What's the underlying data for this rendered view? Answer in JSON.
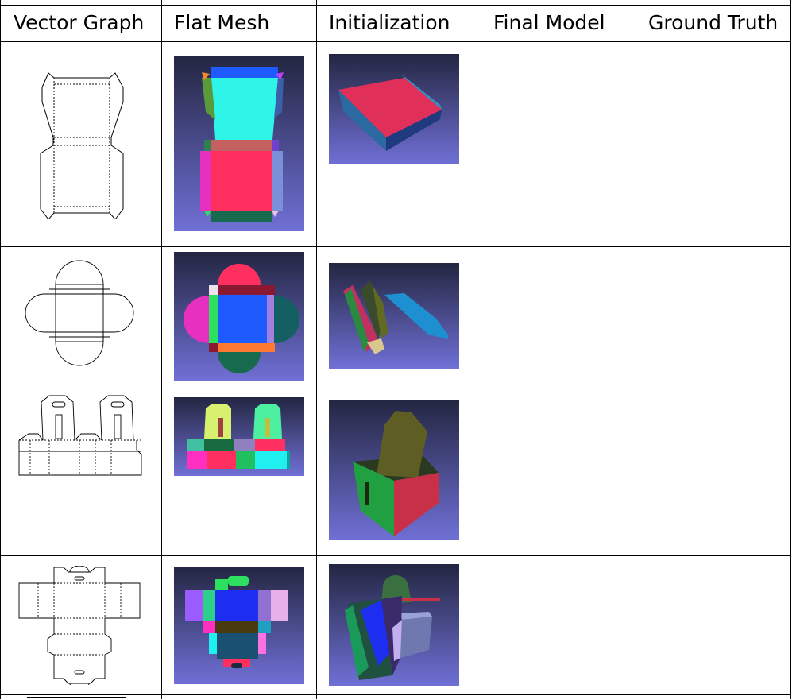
{
  "table": {
    "headers": [
      "Vector Graph",
      "Flat Mesh",
      "Initialization",
      "Final Model",
      "Ground Truth"
    ],
    "rows": [
      {
        "vector_graph": "box-dieline-1",
        "flat_mesh": "flat-mesh-1",
        "initialization": "initialization-1",
        "final_model": "",
        "ground_truth": ""
      },
      {
        "vector_graph": "box-dieline-2",
        "flat_mesh": "flat-mesh-2",
        "initialization": "initialization-2",
        "final_model": "",
        "ground_truth": ""
      },
      {
        "vector_graph": "box-dieline-3",
        "flat_mesh": "flat-mesh-3",
        "initialization": "initialization-3",
        "final_model": "",
        "ground_truth": ""
      },
      {
        "vector_graph": "box-dieline-4",
        "flat_mesh": "flat-mesh-4",
        "initialization": "initialization-4",
        "final_model": "",
        "ground_truth": ""
      }
    ]
  },
  "colors": {
    "render_bg_top": "#262a44",
    "render_bg_bottom": "#6f6fd2",
    "grid_line": "#000000"
  }
}
